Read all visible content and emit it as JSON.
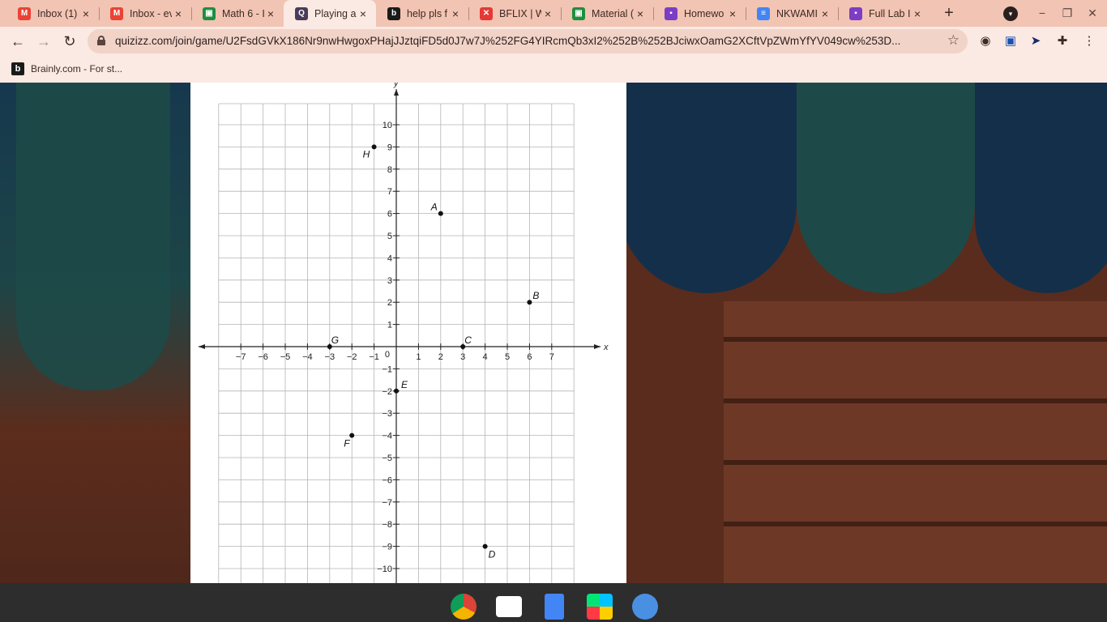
{
  "tabs": [
    {
      "label": "Inbox (1)",
      "icon": "gmail-icon",
      "active": false
    },
    {
      "label": "Inbox - ev",
      "icon": "gmail-icon",
      "active": false
    },
    {
      "label": "Math 6 - I",
      "icon": "classroom-icon",
      "active": false
    },
    {
      "label": "Playing a",
      "icon": "quizizz-icon",
      "active": true
    },
    {
      "label": "help pls f",
      "icon": "brainly-icon",
      "active": false
    },
    {
      "label": "BFLIX | W",
      "icon": "bflix-icon",
      "active": false
    },
    {
      "label": "Material (",
      "icon": "classroom-icon",
      "active": false
    },
    {
      "label": "Homewo",
      "icon": "assignment-icon",
      "active": false
    },
    {
      "label": "NKWAMI",
      "icon": "docs-icon",
      "active": false
    },
    {
      "label": "Full Lab I",
      "icon": "assignment-icon",
      "active": false
    }
  ],
  "address_bar": {
    "url": "quizizz.com/join/game/U2FsdGVkX186Nr9nwHwgoxPHajJJztqiFD5d0J7w7J%252FG4YIRcmQb3xI2%252B%252BJciwxOamG2XCftVpZWmYfYV049cw%253D..."
  },
  "bookmarks": [
    {
      "label": "Brainly.com - For st..."
    }
  ],
  "chart_data": {
    "type": "scatter",
    "title": "",
    "xlabel": "x",
    "ylabel": "y",
    "xlim": [
      -8,
      8
    ],
    "ylim": [
      -11,
      11
    ],
    "x_ticks": [
      -7,
      -6,
      -5,
      -4,
      -3,
      -2,
      -1,
      1,
      2,
      3,
      4,
      5,
      6,
      7
    ],
    "y_ticks": [
      -10,
      -9,
      -8,
      -7,
      -6,
      -5,
      -4,
      -3,
      -2,
      -1,
      1,
      2,
      3,
      4,
      5,
      6,
      7,
      8,
      9,
      10
    ],
    "origin_label": "0",
    "grid": true,
    "points": [
      {
        "label": "A",
        "x": 2,
        "y": 6
      },
      {
        "label": "B",
        "x": 6,
        "y": 2
      },
      {
        "label": "C",
        "x": 3,
        "y": 0
      },
      {
        "label": "D",
        "x": 4,
        "y": -9
      },
      {
        "label": "E",
        "x": 0,
        "y": -2
      },
      {
        "label": "F",
        "x": -2,
        "y": -4
      },
      {
        "label": "G",
        "x": -3,
        "y": 0
      },
      {
        "label": "H",
        "x": -1,
        "y": 9
      }
    ]
  },
  "colors": {
    "tab_strip": "#f2c4b3",
    "toolbar": "#fbe9e3",
    "card": "#ffffff",
    "grid": "#aaaaaa",
    "axis": "#222222"
  }
}
